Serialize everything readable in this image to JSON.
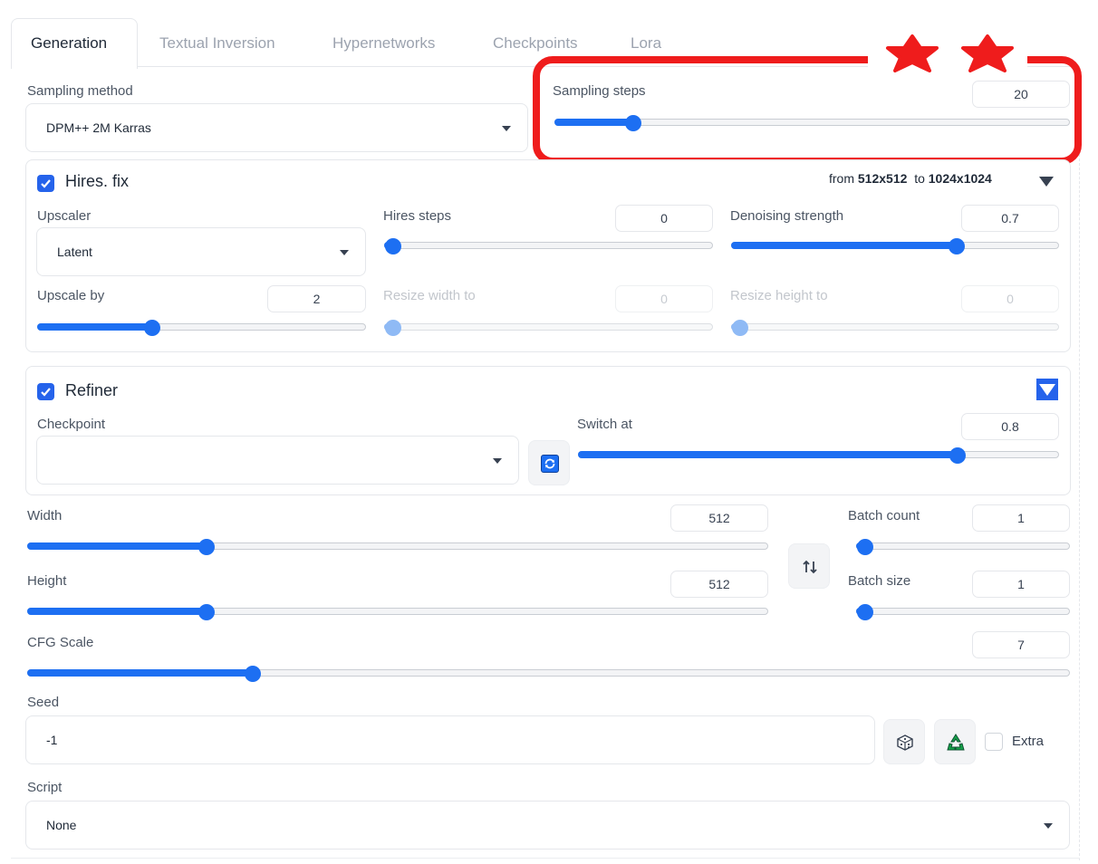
{
  "tabs": [
    "Generation",
    "Textual Inversion",
    "Hypernetworks",
    "Checkpoints",
    "Lora"
  ],
  "sampling_method": {
    "label": "Sampling method",
    "value": "DPM++ 2M Karras"
  },
  "sampling_steps": {
    "label": "Sampling steps",
    "value": "20",
    "fraction": 0.14
  },
  "hires": {
    "title": "Hires. fix",
    "checked": true,
    "info_from": "from",
    "from_size": "512x512",
    "info_to": "to",
    "to_size": "1024x1024",
    "upscaler": {
      "label": "Upscaler",
      "value": "Latent"
    },
    "hires_steps": {
      "label": "Hires steps",
      "value": "0",
      "fraction": 0.0
    },
    "denoising": {
      "label": "Denoising strength",
      "value": "0.7",
      "fraction": 0.7
    },
    "upscale_by": {
      "label": "Upscale by",
      "value": "2",
      "fraction": 0.34
    },
    "resize_width": {
      "label": "Resize width to",
      "value": "0",
      "fraction": 0.0
    },
    "resize_height": {
      "label": "Resize height to",
      "value": "0",
      "fraction": 0.0
    }
  },
  "refiner": {
    "title": "Refiner",
    "checked": true,
    "checkpoint": {
      "label": "Checkpoint",
      "value": ""
    },
    "switch_at": {
      "label": "Switch at",
      "value": "0.8",
      "fraction": 0.8
    }
  },
  "width": {
    "label": "Width",
    "value": "512",
    "fraction": 0.235
  },
  "height": {
    "label": "Height",
    "value": "512",
    "fraction": 0.235
  },
  "batch_count": {
    "label": "Batch count",
    "value": "1",
    "fraction": 0.0
  },
  "batch_size": {
    "label": "Batch size",
    "value": "1",
    "fraction": 0.0
  },
  "cfg_scale": {
    "label": "CFG Scale",
    "value": "7",
    "fraction": 0.211
  },
  "seed": {
    "label": "Seed",
    "value": "-1",
    "extra_label": "Extra"
  },
  "script": {
    "label": "Script",
    "value": "None"
  },
  "colors": {
    "accent": "#1d6ff2",
    "checkbox": "#2563eb",
    "highlight": "#ef1c1c"
  }
}
